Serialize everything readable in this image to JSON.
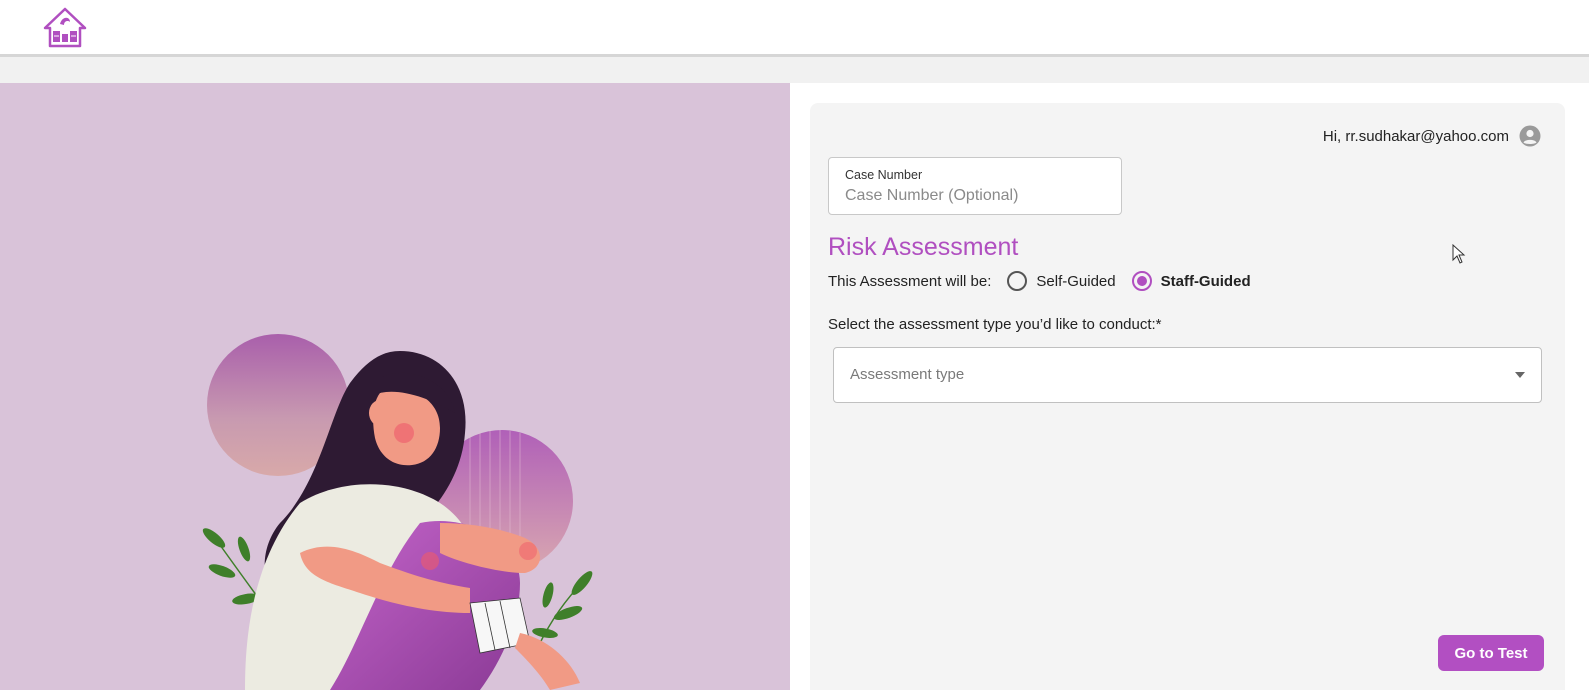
{
  "header": {
    "logo_icon": "house-logo-icon"
  },
  "user": {
    "greeting": "Hi, rr.sudhakar@yahoo.com",
    "avatar_icon": "user-avatar-icon"
  },
  "case_number": {
    "label": "Case Number",
    "placeholder": "Case Number (Optional)",
    "value": ""
  },
  "assessment": {
    "title": "Risk Assessment",
    "mode_label": "This Assessment will be:",
    "options": [
      {
        "label": "Self-Guided",
        "selected": false
      },
      {
        "label": "Staff-Guided",
        "selected": true
      }
    ],
    "select_prompt": "Select the assessment type you’d like to conduct:*",
    "select_placeholder": "Assessment type",
    "go_button": "Go to Test"
  },
  "colors": {
    "accent": "#b04fc0",
    "illustration_bg": "#d9c3d9"
  }
}
